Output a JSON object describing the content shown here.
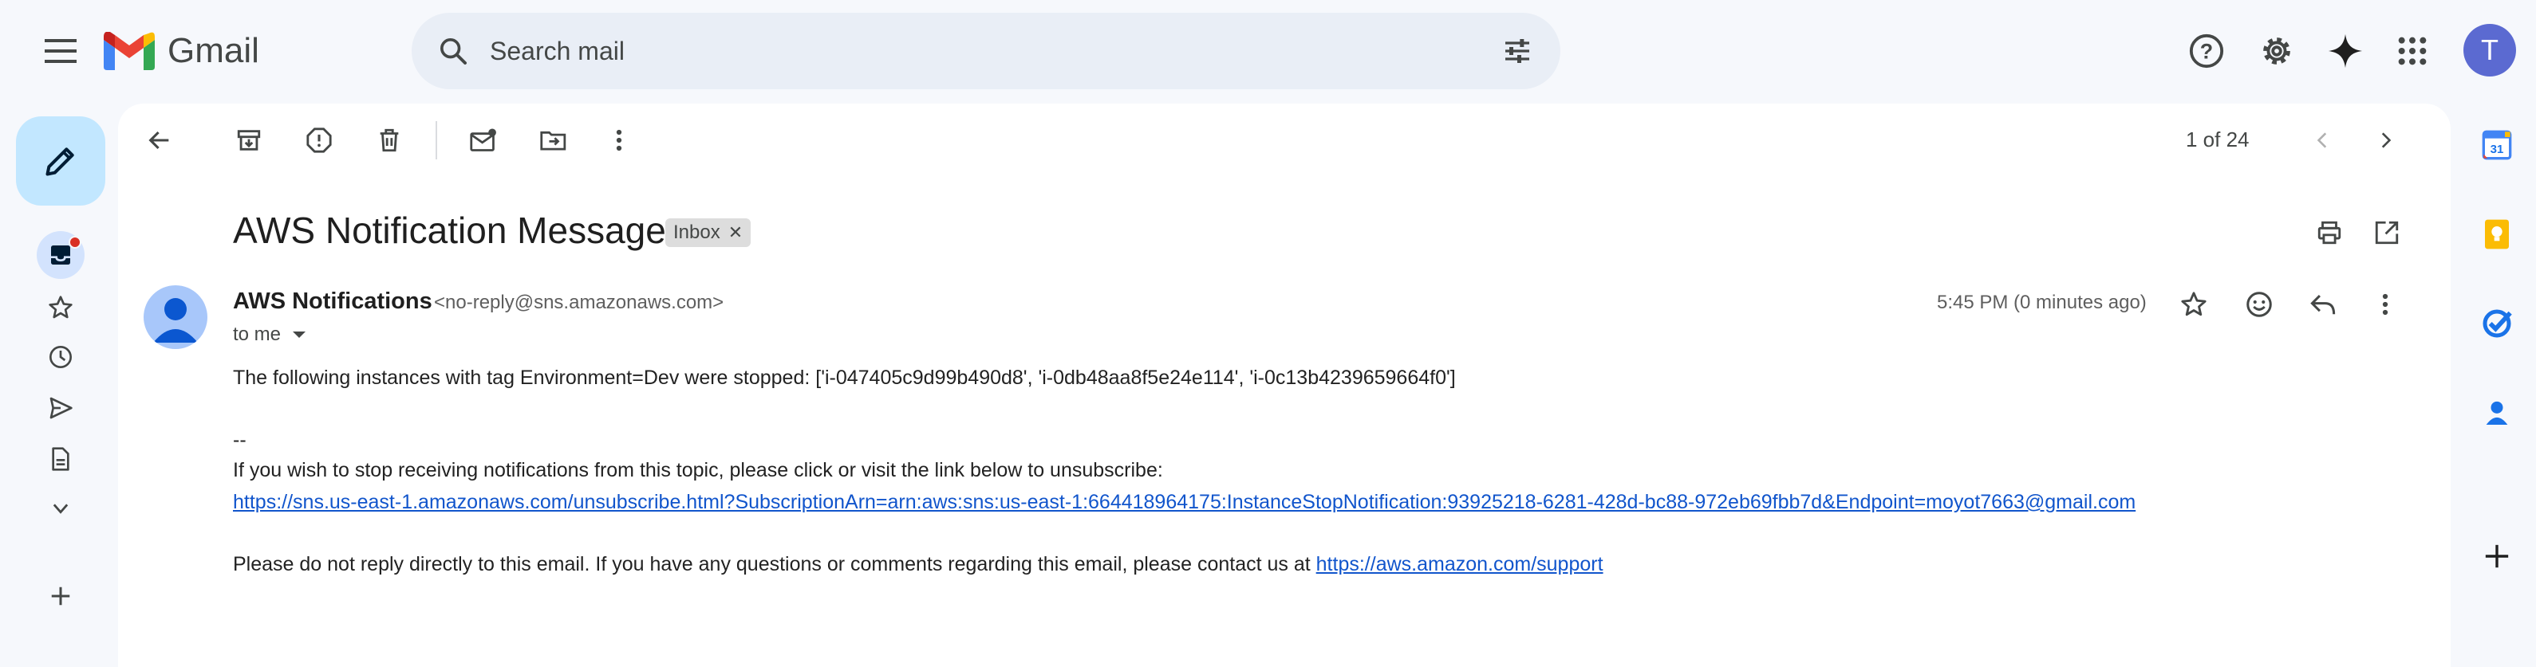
{
  "app": {
    "name": "Gmail"
  },
  "search": {
    "placeholder": "Search mail"
  },
  "user": {
    "avatar_letter": "T"
  },
  "colors": {
    "accent": "#0b57d0",
    "compose_bg": "#c2e7ff",
    "avatar_bg": "#5b6ad1",
    "link": "#1155cc",
    "badge": "#d93025"
  },
  "header_icons": [
    "help-icon",
    "settings-icon",
    "gemini-icon",
    "apps-icon"
  ],
  "left_nav": [
    "inbox-icon",
    "starred-icon",
    "snoozed-icon",
    "sent-icon",
    "drafts-icon",
    "more-icon"
  ],
  "toolbar": {
    "icons": [
      "back-icon",
      "archive-icon",
      "report-spam-icon",
      "delete-icon",
      "mark-unread-icon",
      "move-to-icon",
      "more-vert-icon"
    ],
    "pager": "1 of 24"
  },
  "message": {
    "subject": "AWS Notification Message",
    "label": "Inbox",
    "sender_name": "AWS Notifications",
    "sender_email": "<no-reply@sns.amazonaws.com>",
    "to": "to me",
    "time": "5:45 PM (0 minutes ago)",
    "body_line1": "The following instances with tag Environment=Dev were stopped: ['i-047405c9d99b490d8', 'i-0db48aa8f5e24e114', 'i-0c13b4239659664f0']",
    "separator": "--",
    "unsubscribe_text": "If you wish to stop receiving notifications from this topic, please click or visit the link below to unsubscribe:",
    "unsubscribe_link": "https://sns.us-east-1.amazonaws.com/unsubscribe.html?SubscriptionArn=arn:aws:sns:us-east-1:664418964175:InstanceStopNotification:93925218-6281-428d-bc88-972eb69fbb7d&Endpoint=moyot7663@gmail.com",
    "contact_text": "Please do not reply directly to this email. If you have any questions or comments regarding this email, please contact us at ",
    "contact_link": "https://aws.amazon.com/support"
  },
  "side_panel": {
    "calendar_day": "31",
    "apps": [
      "calendar-icon",
      "keep-icon",
      "tasks-icon",
      "contacts-icon",
      "add-addon-icon"
    ]
  }
}
